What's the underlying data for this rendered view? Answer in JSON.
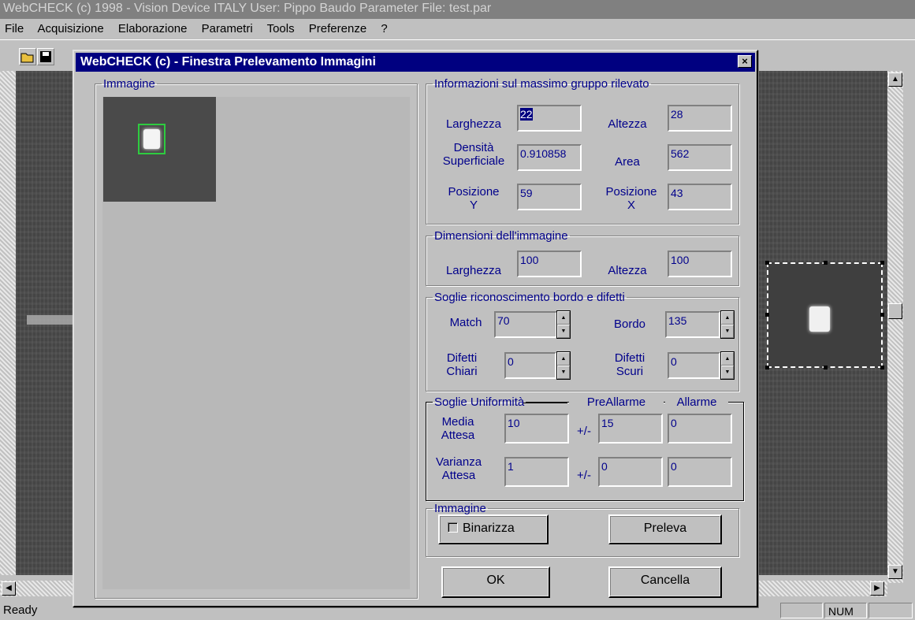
{
  "app_title": "WebCHECK (c) 1998 - Vision Device ITALY   User: Pippo Baudo   Parameter File: test.par",
  "menu": [
    "File",
    "Acquisizione",
    "Elaborazione",
    "Parametri",
    "Tools",
    "Preferenze",
    "?"
  ],
  "status": {
    "ready": "Ready",
    "num": "NUM"
  },
  "dialog": {
    "title": "WebCHECK (c) - Finestra Prelevamento Immagini",
    "close": "×",
    "image_group": "Immagine",
    "info": {
      "legend": "Informazioni sul massimo gruppo rilevato",
      "larghezza_label": "Larghezza",
      "larghezza": "22",
      "altezza_label": "Altezza",
      "altezza": "28",
      "densita_label_1": "Densità",
      "densita_label_2": "Superficiale",
      "densita": "0.910858",
      "area_label": "Area",
      "area": "562",
      "posy_label_1": "Posizione",
      "posy_label_2": "Y",
      "posy": "59",
      "posx_label_1": "Posizione",
      "posx_label_2": "X",
      "posx": "43"
    },
    "dims": {
      "legend": "Dimensioni dell'immagine",
      "larghezza_label": "Larghezza",
      "larghezza": "100",
      "altezza_label": "Altezza",
      "altezza": "100"
    },
    "soglie": {
      "legend": "Soglie riconoscimento bordo e difetti",
      "match_label": "Match",
      "match": "70",
      "bordo_label": "Bordo",
      "bordo": "135",
      "chiari_label_1": "Difetti",
      "chiari_label_2": "Chiari",
      "chiari": "0",
      "scuri_label_1": "Difetti",
      "scuri_label_2": "Scuri",
      "scuri": "0"
    },
    "unif": {
      "legend": "Soglie Uniformità",
      "prealarm": "PreAllarme",
      "alarm": "Allarme",
      "media_label_1": "Media",
      "media_label_2": "Attesa",
      "media": "10",
      "pm1": "+/-",
      "media_pre": "15",
      "media_al": "0",
      "var_label_1": "Varianza",
      "var_label_2": "Attesa",
      "var": "1",
      "pm2": "+/-",
      "var_pre": "0",
      "var_al": "0"
    },
    "img_group2": "Immagine",
    "binarizza": "Binarizza",
    "preleva": "Preleva",
    "ok": "OK",
    "cancella": "Cancella"
  }
}
